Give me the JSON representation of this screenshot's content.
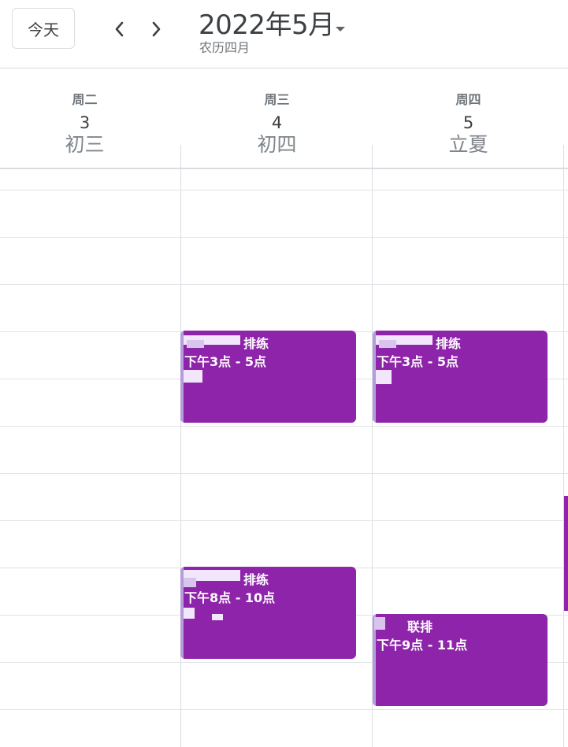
{
  "header": {
    "today_label": "今天",
    "prev_icon": "chevron-left-icon",
    "next_icon": "chevron-right-icon",
    "title": "2022年5月",
    "subtitle": "农历四月",
    "dropdown_icon": "caret-down-icon"
  },
  "days": [
    {
      "weekday": "周二",
      "date": "3",
      "lunar": "初三"
    },
    {
      "weekday": "周三",
      "date": "4",
      "lunar": "初四"
    },
    {
      "weekday": "周四",
      "date": "5",
      "lunar": "立夏"
    }
  ],
  "events": [
    {
      "title": "排练",
      "time": "下午3点 - 5点"
    },
    {
      "title": "排练",
      "time": "下午3点 - 5点"
    },
    {
      "title": "排练",
      "time": "下午8点 - 10点"
    },
    {
      "title": "联排",
      "time": "下午9点 - 11点"
    }
  ],
  "colors": {
    "event": "#8e24aa",
    "grid": "#dadce0",
    "text": "#3c4043",
    "muted": "#70757a"
  }
}
